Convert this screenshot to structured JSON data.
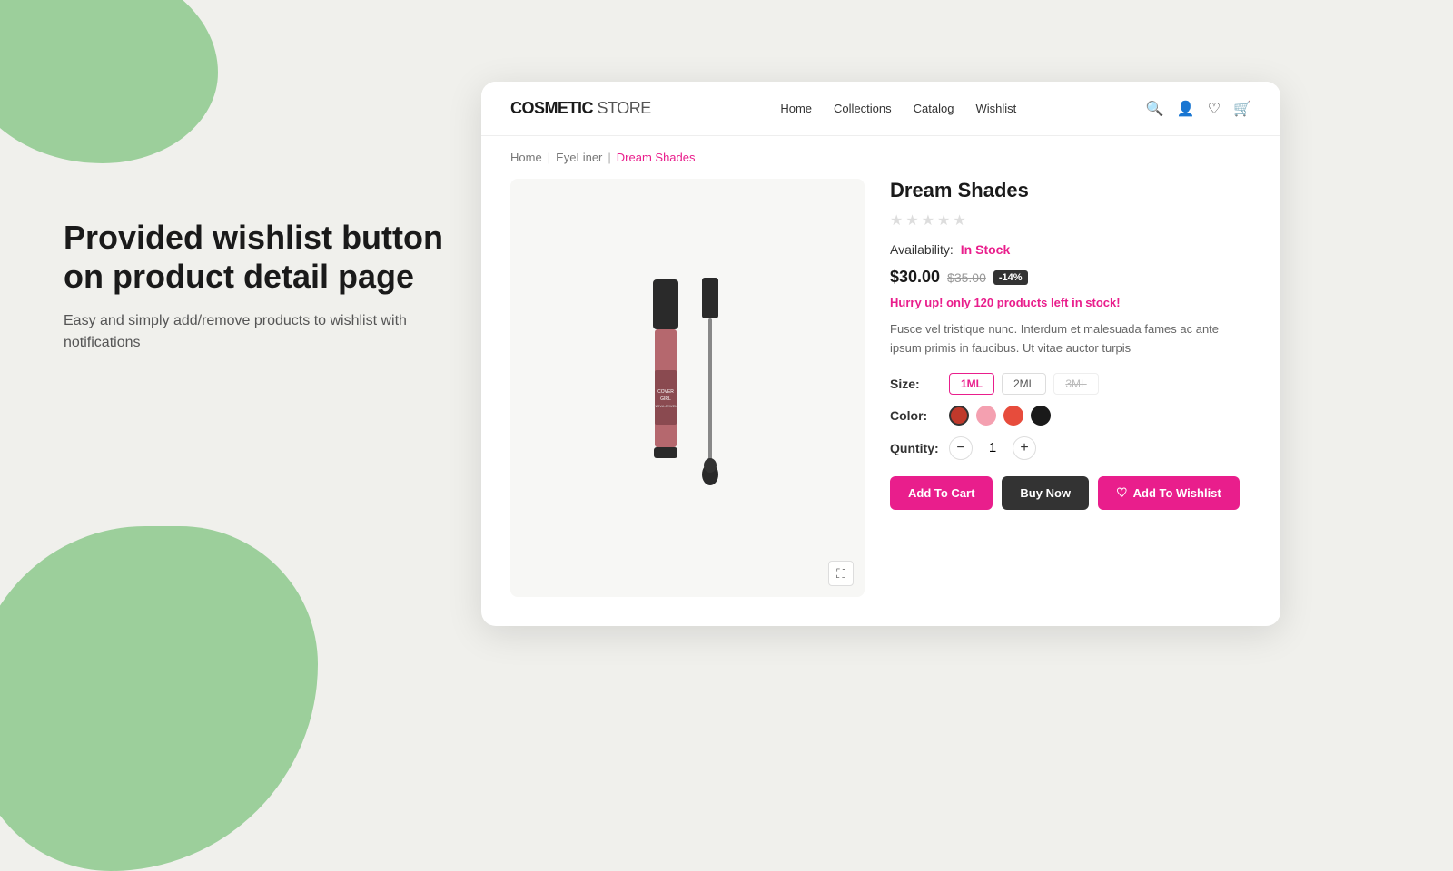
{
  "background": {
    "color": "#f0f0ec"
  },
  "left_panel": {
    "heading": "Provided wishlist button on product detail page",
    "description": "Easy and simply add/remove products to wishlist with notifications"
  },
  "nav": {
    "logo_bold": "COSMETIC",
    "logo_regular": " STORE",
    "links": [
      "Home",
      "Collections",
      "Catalog",
      "Wishlist"
    ],
    "icons": [
      "search",
      "user",
      "heart",
      "cart"
    ]
  },
  "breadcrumb": {
    "home": "Home",
    "category": "EyeLiner",
    "current": "Dream Shades"
  },
  "product": {
    "title": "Dream Shades",
    "rating": 0,
    "availability_label": "Availability:",
    "availability_value": "In Stock",
    "price_current": "$30.00",
    "price_original": "$35.00",
    "price_badge": "-14%",
    "hurry_text_before": "Hurry up! only ",
    "hurry_count": "120",
    "hurry_text_after": " products left in stock!",
    "description": "Fusce vel tristique nunc. Interdum et malesuada fames ac ante ipsum primis in faucibus. Ut vitae auctor turpis",
    "size_label": "Size:",
    "sizes": [
      {
        "label": "1ML",
        "state": "active"
      },
      {
        "label": "2ML",
        "state": "normal"
      },
      {
        "label": "3ML",
        "state": "inactive"
      }
    ],
    "color_label": "Color:",
    "colors": [
      {
        "hex": "#c0392b",
        "selected": true
      },
      {
        "hex": "#f4a0b0",
        "selected": false
      },
      {
        "hex": "#e74c3c",
        "selected": false
      },
      {
        "hex": "#1a1a1a",
        "selected": false
      }
    ],
    "quantity_label": "Quntity:",
    "quantity": 1,
    "buttons": {
      "add_to_cart": "Add To Cart",
      "buy_now": "Buy Now",
      "add_to_wishlist": "Add To Wishlist"
    }
  }
}
